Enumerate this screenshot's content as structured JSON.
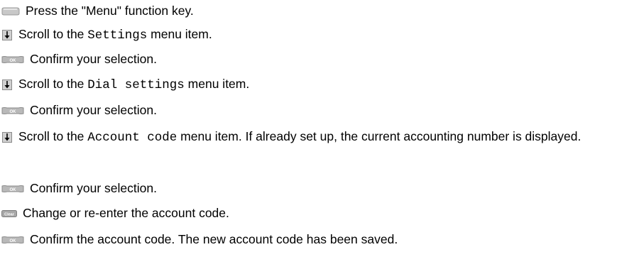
{
  "steps": [
    {
      "icon": "menu-key-icon",
      "text": "Press the \"Menu\" function key."
    },
    {
      "icon": "scroll-down-icon",
      "pre": "Scroll to the ",
      "code": "Settings",
      "post": " menu item."
    },
    {
      "icon": "ok-key-icon",
      "text": "Confirm your selection."
    },
    {
      "icon": "scroll-down-icon",
      "pre": "Scroll to the ",
      "code": "Dial settings",
      "post": " menu item."
    },
    {
      "icon": "ok-key-icon",
      "text": "Confirm your selection."
    },
    {
      "icon": "scroll-down-icon",
      "pre": "Scroll to the ",
      "code": "Account code",
      "post": " menu item. If already set up, the current accounting number is displayed."
    },
    {
      "icon": "ok-key-icon",
      "text": "Confirm your selection."
    },
    {
      "icon": "clear-key-icon",
      "text": "Change or re-enter the account code.",
      "key_label": "Clear"
    },
    {
      "icon": "ok-key-icon",
      "text": "Confirm the account code. The new account code has been saved.",
      "key_label": "OK"
    }
  ]
}
